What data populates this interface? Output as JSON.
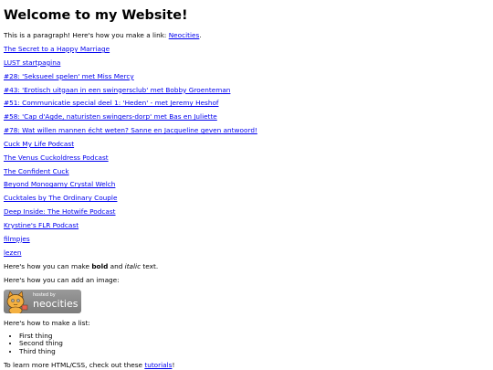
{
  "heading": "Welcome to my Website!",
  "intro": {
    "text": "This is a paragraph! Here's how you make a link: ",
    "link": "Neocities",
    "end": "."
  },
  "links": [
    "The Secret to a Happy Marriage",
    "LUST startpagina",
    "#28: 'Seksueel spelen' met Miss Mercy",
    "#43: 'Erotisch uitgaan in een swingersclub' met Bobby Groenteman",
    "#51: Communicatie special deel 1: 'Heden' - met Jeremy Heshof",
    "#58: 'Cap d'Agde, naturisten swingers-dorp' met Bas en Juliette",
    "#78: Wat willen mannen écht weten? Sanne en Jacqueline geven antwoord!",
    "Cuck My Life Podcast",
    "The Venus Cuckoldress Podcast",
    "The Confident Cuck",
    "Beyond Monogamy Crystal Welch",
    "Cucktales by The Ordinary Couple",
    "Deep Inside: The Hotwife Podcast",
    "Krystine's FLR Podcast",
    "filmpjes",
    "lezen"
  ],
  "formatting": {
    "before": "Here's how you can make ",
    "bold": "bold",
    "middle": " and ",
    "italic": "italic",
    "after": " text."
  },
  "image_line": "Here's how you can add an image:",
  "badge": {
    "small_text": "hosted by",
    "big_text": "neocities",
    "icon": "neocities-cat-icon"
  },
  "list_line": "Here's how to make a list:",
  "list_items": [
    "First thing",
    "Second thing",
    "Third thing"
  ],
  "outro": {
    "text": "To learn more HTML/CSS, check out these ",
    "link": "tutorials",
    "end": "!"
  },
  "colors": {
    "link": "#0000ee",
    "text": "#000000",
    "background": "#ffffff"
  }
}
